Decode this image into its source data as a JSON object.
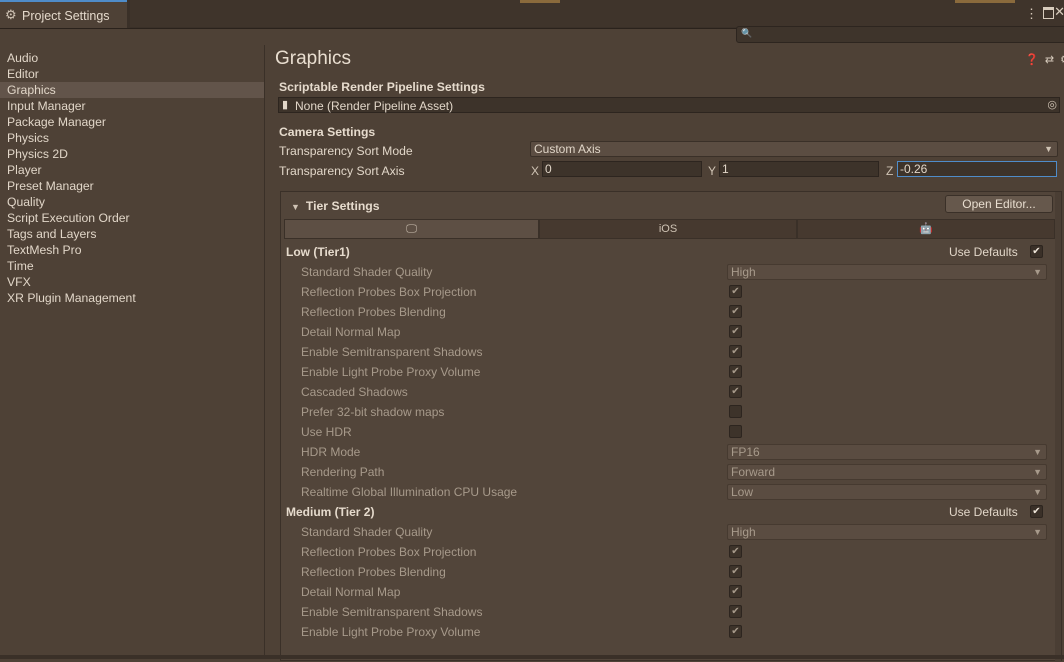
{
  "window": {
    "title": "Project Settings"
  },
  "sidebar": {
    "items": [
      {
        "label": "Audio"
      },
      {
        "label": "Editor"
      },
      {
        "label": "Graphics"
      },
      {
        "label": "Input Manager"
      },
      {
        "label": "Package Manager"
      },
      {
        "label": "Physics"
      },
      {
        "label": "Physics 2D"
      },
      {
        "label": "Player"
      },
      {
        "label": "Preset Manager"
      },
      {
        "label": "Quality"
      },
      {
        "label": "Script Execution Order"
      },
      {
        "label": "Tags and Layers"
      },
      {
        "label": "TextMesh Pro"
      },
      {
        "label": "Time"
      },
      {
        "label": "VFX"
      },
      {
        "label": "XR Plugin Management"
      }
    ],
    "selected": "Graphics"
  },
  "main": {
    "title": "Graphics",
    "srp": {
      "heading": "Scriptable Render Pipeline Settings",
      "value": "None (Render Pipeline Asset)"
    },
    "camera": {
      "heading": "Camera Settings",
      "sort_mode_label": "Transparency Sort Mode",
      "sort_mode_value": "Custom Axis",
      "sort_axis_label": "Transparency Sort Axis",
      "x_label": "X",
      "x": "0",
      "y_label": "Y",
      "y": "1",
      "z_label": "Z",
      "z": "-0.26"
    },
    "tier": {
      "heading": "Tier Settings",
      "open_editor": "Open Editor...",
      "platform_tabs": [
        "desktop-icon",
        "iOS",
        "android-icon"
      ],
      "ios_label": "iOS",
      "use_defaults": "Use Defaults",
      "low": {
        "title": "Low (Tier1)",
        "rows": [
          {
            "label": "Standard Shader Quality",
            "kind": "dropdown",
            "value": "High"
          },
          {
            "label": "Reflection Probes Box Projection",
            "kind": "check",
            "checked": true
          },
          {
            "label": "Reflection Probes Blending",
            "kind": "check",
            "checked": true
          },
          {
            "label": "Detail Normal Map",
            "kind": "check",
            "checked": true
          },
          {
            "label": "Enable Semitransparent Shadows",
            "kind": "check",
            "checked": true
          },
          {
            "label": "Enable Light Probe Proxy Volume",
            "kind": "check",
            "checked": true
          },
          {
            "label": "Cascaded Shadows",
            "kind": "check",
            "checked": true
          },
          {
            "label": "Prefer 32-bit shadow maps",
            "kind": "check",
            "checked": false
          },
          {
            "label": "Use HDR",
            "kind": "check",
            "checked": false
          },
          {
            "label": "HDR Mode",
            "kind": "dropdown",
            "value": "FP16"
          },
          {
            "label": "Rendering Path",
            "kind": "dropdown",
            "value": "Forward"
          },
          {
            "label": "Realtime Global Illumination CPU Usage",
            "kind": "dropdown",
            "value": "Low"
          }
        ]
      },
      "medium": {
        "title": "Medium (Tier 2)",
        "rows": [
          {
            "label": "Standard Shader Quality",
            "kind": "dropdown",
            "value": "High"
          },
          {
            "label": "Reflection Probes Box Projection",
            "kind": "check",
            "checked": true
          },
          {
            "label": "Reflection Probes Blending",
            "kind": "check",
            "checked": true
          },
          {
            "label": "Detail Normal Map",
            "kind": "check",
            "checked": true
          },
          {
            "label": "Enable Semitransparent Shadows",
            "kind": "check",
            "checked": true
          },
          {
            "label": "Enable Light Probe Proxy Volume",
            "kind": "check",
            "checked": true
          }
        ]
      }
    }
  },
  "colors": {
    "accent": "#4f8cc9",
    "panel": "#4e4136",
    "selected": "#62544a"
  }
}
